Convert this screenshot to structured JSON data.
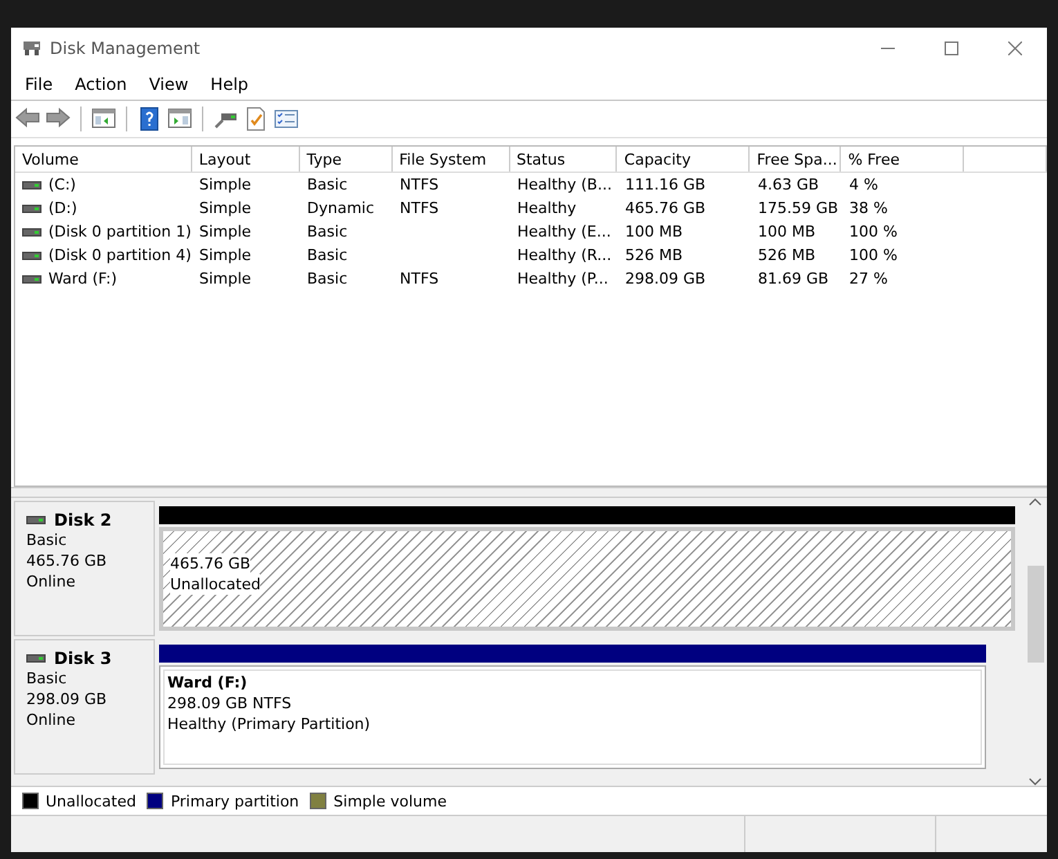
{
  "window": {
    "title": "Disk Management"
  },
  "menu": [
    "File",
    "Action",
    "View",
    "Help"
  ],
  "table": {
    "columns": [
      "Volume",
      "Layout",
      "Type",
      "File System",
      "Status",
      "Capacity",
      "Free Spa...",
      "% Free"
    ],
    "rows": [
      [
        "(C:)",
        "Simple",
        "Basic",
        "NTFS",
        "Healthy (B...",
        "111.16 GB",
        "4.63 GB",
        "4 %"
      ],
      [
        "(D:)",
        "Simple",
        "Dynamic",
        "NTFS",
        "Healthy",
        "465.76 GB",
        "175.59 GB",
        "38 %"
      ],
      [
        "(Disk 0 partition 1)",
        "Simple",
        "Basic",
        "",
        "Healthy (E...",
        "100 MB",
        "100 MB",
        "100 %"
      ],
      [
        "(Disk 0 partition 4)",
        "Simple",
        "Basic",
        "",
        "Healthy (R...",
        "526 MB",
        "526 MB",
        "100 %"
      ],
      [
        "Ward (F:)",
        "Simple",
        "Basic",
        "NTFS",
        "Healthy (P...",
        "298.09 GB",
        "81.69 GB",
        "27 %"
      ]
    ]
  },
  "disks": [
    {
      "name": "Disk 2",
      "type": "Basic",
      "size": "465.76 GB",
      "status": "Online",
      "partitions": [
        {
          "kind": "unallocated",
          "lines": [
            "465.76 GB",
            "Unallocated"
          ]
        }
      ]
    },
    {
      "name": "Disk 3",
      "type": "Basic",
      "size": "298.09 GB",
      "status": "Online",
      "partitions": [
        {
          "kind": "primary",
          "title": "Ward  (F:)",
          "lines": [
            "298.09 GB NTFS",
            "Healthy (Primary Partition)"
          ]
        }
      ]
    }
  ],
  "legend": [
    {
      "label": "Unallocated",
      "color": "#000000"
    },
    {
      "label": "Primary partition",
      "color": "#000080"
    },
    {
      "label": "Simple volume",
      "color": "#808040"
    }
  ]
}
